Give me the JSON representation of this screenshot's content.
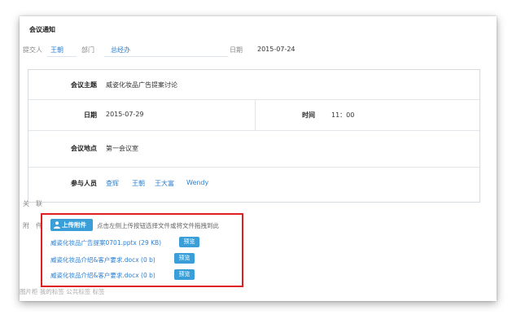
{
  "form": {
    "title": "会议通知",
    "submitter_label": "提交人",
    "submitter_value": "王朝",
    "dept_label": "部门",
    "dept_value": "总经办",
    "date_label": "日期",
    "date_value": "2015-07-24"
  },
  "details": {
    "topic_label": "会议主题",
    "topic_value": "威姿化妆品广告提案讨论",
    "date_label": "日期",
    "date_value": "2015-07-29",
    "time_label": "时间",
    "time_value": "11：00",
    "location_label": "会议地点",
    "location_value": "第一会议室",
    "attendees_label": "参与人员",
    "attendees": [
      "查辉",
      "王朝",
      "王大富",
      "Wendy"
    ]
  },
  "related": {
    "label": "关　联"
  },
  "attachments": {
    "label": "附　件",
    "upload_button": "上传附件",
    "hint": "点击左侧上传按钮选择文件或将文件拖拽到此",
    "preview_label": "预览",
    "files": [
      "威姿化妆品广告提案0701.pptx (29 KB)",
      "威姿化妆品介绍&客户要求.docx (0 b)",
      "威姿化妆品介绍&客户要求.docx (0 b)"
    ]
  },
  "footer": {
    "text": "图片柜  我的标签  公共标签  标签"
  },
  "colors": {
    "accent": "#3a9ed8",
    "link": "#2b7fd0",
    "highlight": "#e02020"
  }
}
